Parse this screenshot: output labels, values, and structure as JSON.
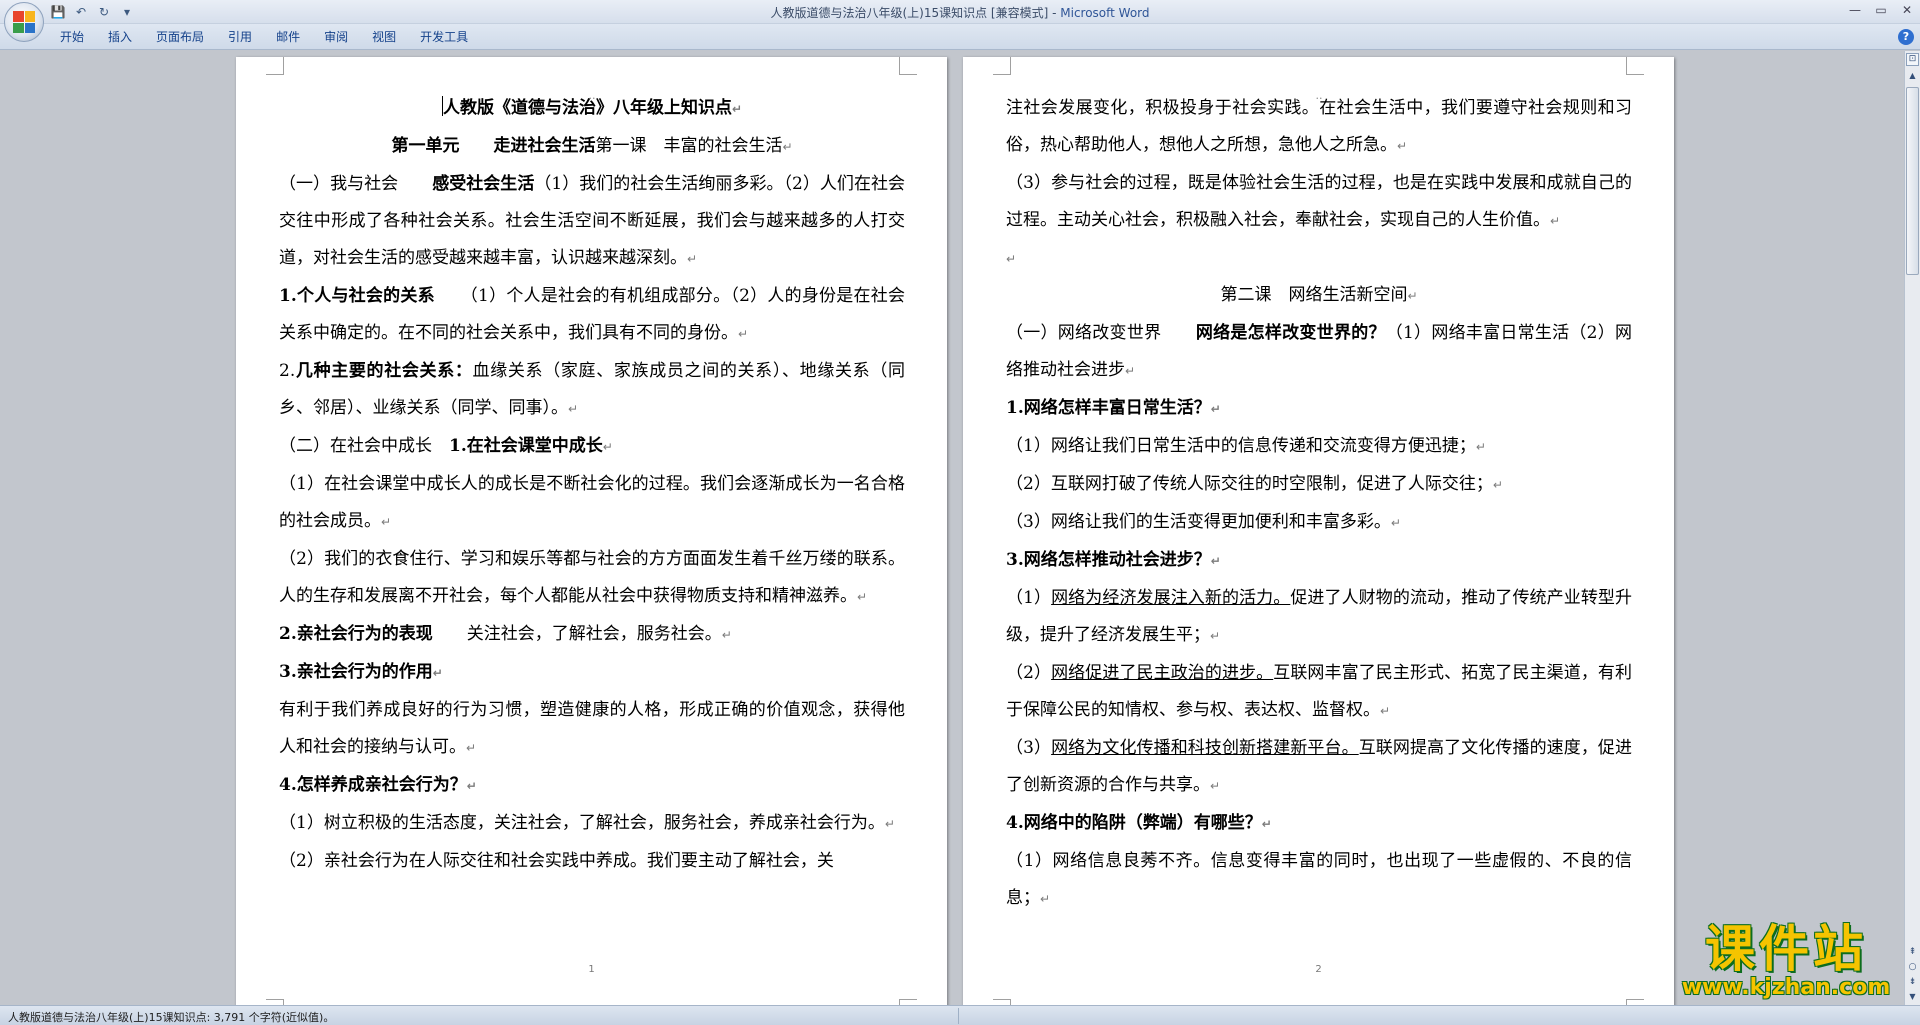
{
  "window": {
    "title": "人教版道德与法治八年级(上)15课知识点 [兼容模式] - ",
    "app_name": "Microsoft Word",
    "office_logo_colors": [
      "#e8452c",
      "#f8b51d",
      "#3a9d4a",
      "#2a73c8"
    ]
  },
  "quick_access": {
    "save_icon": "💾",
    "undo_icon": "↶",
    "redo_icon": "↻",
    "customize_icon": "▾"
  },
  "win_controls": {
    "minimize": "—",
    "restore": "▭",
    "close": "✕"
  },
  "ribbon": {
    "tabs": [
      "开始",
      "插入",
      "页面布局",
      "引用",
      "邮件",
      "审阅",
      "视图",
      "开发工具"
    ],
    "help": "?"
  },
  "marks": {
    "para": "↵"
  },
  "page1": {
    "tiny": "..",
    "title": "人教版《道德与法治》八年级上知识点",
    "unit_part1": "第一单元",
    "unit_part2": "走进社会生活",
    "unit_part3": "第一课　丰富的社会生活",
    "s1_a": "（一）我与社会　　",
    "s1_b": "感受社会生活",
    "s1_c": "（1）我们的社会生活绚丽多彩。（2）人们在社会交往中形成了各种社会关系。社会生活空间不断延展，我们会与越来越多的人打交道，对社会生活的感受越来越丰富，认识越来越深刻。",
    "s2_a": "1.个人与社会的关系",
    "s2_b": "　　（1）个人是社会的有机组成部分。（2）人的身份是在社会关系中确定的。在不同的社会关系中，我们具有不同的身份。",
    "s3_a": "2.",
    "s3_b": "几种主要的社会关系：",
    "s3_c": "血缘关系（家庭、家族成员之间的关系）、地缘关系（同乡、邻居）、业缘关系（同学、同事）。",
    "s4_a": "（二）在社会中成长　",
    "s4_b": "1.在社会课堂中成长",
    "s5": "（1）在社会课堂中成长人的成长是不断社会化的过程。我们会逐渐成长为一名合格的社会成员。",
    "s6": "（2）我们的衣食住行、学习和娱乐等都与社会的方方面面发生着千丝万缕的联系。人的生存和发展离不开社会，每个人都能从社会中获得物质支持和精神滋养。",
    "s7_a": "2.亲社会行为的表现",
    "s7_b": "　　关注社会，了解社会，服务社会。",
    "s8": "3.亲社会行为的作用",
    "s9": "有利于我们养成良好的行为习惯，塑造健康的人格，形成正确的价值观念，获得他人和社会的接纳与认可。",
    "s10": "4.怎样养成亲社会行为？",
    "s11": "（1）树立积极的生活态度，关注社会，了解社会，服务社会，养成亲社会行为。",
    "s12": "（2）亲社会行为在人际交往和社会实践中养成。我们要主动了解社会，关",
    "page_number": "1"
  },
  "page2": {
    "tiny": "..",
    "t1": "注社会发展变化，积极投身于社会实践。在社会生活中，我们要遵守社会规则和习俗，热心帮助他人，想他人之所想，急他人之所急。",
    "t2": "（3）参与社会的过程，既是体验社会生活的过程，也是在实践中发展和成就自己的过程。主动关心社会，积极融入社会，奉献社会，实现自己的人生价值。",
    "lesson2": "第二课　网络生活新空间",
    "t3_a": "（一）网络改变世界　　",
    "t3_b": "网络是怎样改变世界的？",
    "t3_c": "（1）网络丰富日常生活（2）网络推动社会进步",
    "t4": "1.网络怎样丰富日常生活？",
    "t5": "（1）网络让我们日常生活中的信息传递和交流变得方便迅捷；",
    "t6": "（2）互联网打破了传统人际交往的时空限制，促进了人际交往；",
    "t7": "（3）网络让我们的生活变得更加便利和丰富多彩。",
    "t8": "3.网络怎样推动社会进步？",
    "t9_a": "（1）",
    "t9_b": "网络为经济发展注入新的活力。",
    "t9_c": "促进了人财物的流动，推动了传统产业转型升级，提升了经济发展生平；",
    "t10_a": "（2）",
    "t10_b": "网络促进了民主政治的进步。",
    "t10_c": "互联网丰富了民主形式、拓宽了民主渠道，有利于保障公民的知情权、参与权、表达权、监督权。",
    "t11_a": "（3）",
    "t11_b": "网络为文化传播和科技创新搭建新平台。",
    "t11_c": "互联网提高了文化传播的速度，促进了创新资源的合作与共享。",
    "t12_a": "4.",
    "t12_b": "网络中的陷阱（弊端）有哪些？",
    "t13": "（1）网络信息良莠不齐。信息变得丰富的同时，也出现了一些虚假的、不良的信息；",
    "page_number": "2"
  },
  "scrollbar": {
    "up": "▲",
    "down": "▼",
    "prev": "⇞",
    "select": "○",
    "next": "⇟",
    "ruler": "⊡"
  },
  "statusbar": {
    "text": "人教版道德与法治八年级(上)15课知识点: 3,791 个字符(近似值)。"
  },
  "watermark": {
    "title": "课件站",
    "url": "www.kjzhan.com"
  }
}
